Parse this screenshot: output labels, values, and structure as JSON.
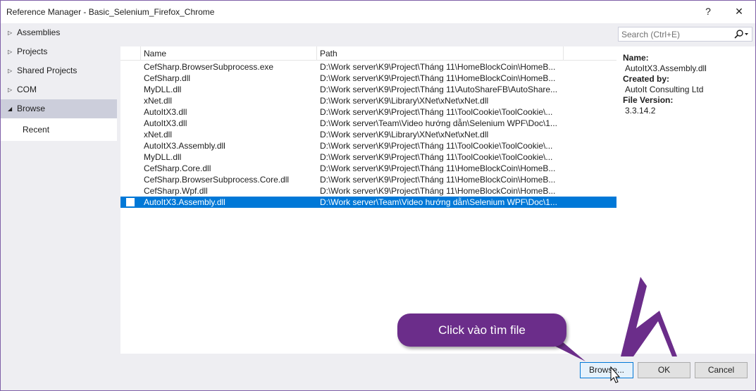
{
  "window": {
    "title": "Reference Manager - Basic_Selenium_Firefox_Chrome",
    "help_label": "?",
    "close_label": "✕"
  },
  "sidebar": {
    "items": [
      {
        "label": "Assemblies",
        "arrow": "▷"
      },
      {
        "label": "Projects",
        "arrow": "▷"
      },
      {
        "label": "Shared Projects",
        "arrow": "▷"
      },
      {
        "label": "COM",
        "arrow": "▷"
      },
      {
        "label": "Browse",
        "arrow": "◢"
      },
      {
        "label": "Recent"
      }
    ]
  },
  "search": {
    "placeholder": "Search (Ctrl+E)",
    "icon": "search-icon"
  },
  "list": {
    "columns": [
      "Name",
      "Path"
    ],
    "rows": [
      {
        "name": "CefSharp.BrowserSubprocess.exe",
        "path": "D:\\Work server\\K9\\Project\\Tháng 11\\HomeBlockCoin\\HomeB..."
      },
      {
        "name": "CefSharp.dll",
        "path": "D:\\Work server\\K9\\Project\\Tháng 11\\HomeBlockCoin\\HomeB..."
      },
      {
        "name": "MyDLL.dll",
        "path": "D:\\Work server\\K9\\Project\\Tháng 11\\AutoShareFB\\AutoShare..."
      },
      {
        "name": "xNet.dll",
        "path": "D:\\Work server\\K9\\Library\\XNet\\xNet\\xNet.dll"
      },
      {
        "name": "AutoItX3.dll",
        "path": "D:\\Work server\\K9\\Project\\Tháng 11\\ToolCookie\\ToolCookie\\..."
      },
      {
        "name": "AutoItX3.dll",
        "path": "D:\\Work server\\Team\\Video hướng dẫn\\Selenium WPF\\Doc\\1..."
      },
      {
        "name": "xNet.dll",
        "path": "D:\\Work server\\K9\\Library\\XNet\\xNet\\xNet.dll"
      },
      {
        "name": "AutoItX3.Assembly.dll",
        "path": "D:\\Work server\\K9\\Project\\Tháng 11\\ToolCookie\\ToolCookie\\..."
      },
      {
        "name": "MyDLL.dll",
        "path": "D:\\Work server\\K9\\Project\\Tháng 11\\ToolCookie\\ToolCookie\\..."
      },
      {
        "name": "CefSharp.Core.dll",
        "path": "D:\\Work server\\K9\\Project\\Tháng 11\\HomeBlockCoin\\HomeB..."
      },
      {
        "name": "CefSharp.BrowserSubprocess.Core.dll",
        "path": "D:\\Work server\\K9\\Project\\Tháng 11\\HomeBlockCoin\\HomeB..."
      },
      {
        "name": "CefSharp.Wpf.dll",
        "path": "D:\\Work server\\K9\\Project\\Tháng 11\\HomeBlockCoin\\HomeB..."
      },
      {
        "name": "AutoItX3.Assembly.dll",
        "path": "D:\\Work server\\Team\\Video hướng dẫn\\Selenium WPF\\Doc\\1...",
        "selected": true
      }
    ]
  },
  "details": {
    "name_label": "Name:",
    "name_value": "AutoItX3.Assembly.dll",
    "created_label": "Created by:",
    "created_value": "AutoIt Consulting Ltd",
    "version_label": "File Version:",
    "version_value": "3.3.14.2"
  },
  "buttons": {
    "browse": "Browse...",
    "ok": "OK",
    "cancel": "Cancel"
  },
  "callout": {
    "text": "Click vào tìm file",
    "color": "#6b2d8a"
  },
  "colors": {
    "selection": "#0078d7",
    "accent": "#6b2d8a"
  }
}
